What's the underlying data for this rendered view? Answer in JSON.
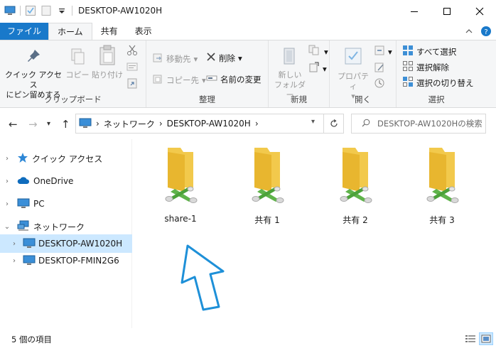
{
  "window": {
    "title": "DESKTOP-AW1020H"
  },
  "ribbon_tabs": {
    "file": "ファイル",
    "home": "ホーム",
    "share": "共有",
    "view": "表示"
  },
  "clipboard": {
    "pin_quick_access": "クイック アクセス\nにピン留めする",
    "copy": "コピー",
    "paste": "貼り付け",
    "label": "クリップボード"
  },
  "organize": {
    "move_to": "移動先",
    "copy_to": "コピー先",
    "delete": "削除",
    "rename": "名前の変更",
    "label": "整理"
  },
  "new_group": {
    "new_folder": "新しい\nフォルダー",
    "label": "新規"
  },
  "open_group": {
    "properties": "プロパティ",
    "label": "開く"
  },
  "select_group": {
    "select_all": "すべて選択",
    "select_none": "選択解除",
    "invert_selection": "選択の切り替え",
    "label": "選択"
  },
  "address": {
    "crumbs": [
      "ネットワーク",
      "DESKTOP-AW1020H"
    ],
    "search_placeholder": "DESKTOP-AW1020Hの検索"
  },
  "nav": {
    "quick_access": "クイック アクセス",
    "onedrive": "OneDrive",
    "pc": "PC",
    "network": "ネットワーク",
    "host_selected": "DESKTOP-AW1020H",
    "host_other": "DESKTOP-FMIN2G6"
  },
  "folders": [
    "share-1",
    "共有 1",
    "共有 2",
    "共有 3"
  ],
  "status": {
    "item_count": "5 個の項目"
  },
  "colors": {
    "accent": "#1979ca",
    "selection": "#cce8ff",
    "arrow": "#1e90d8"
  }
}
